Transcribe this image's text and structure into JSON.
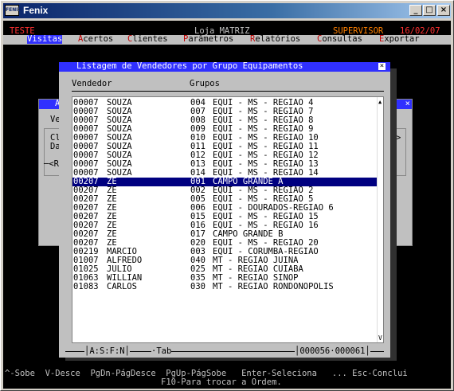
{
  "window": {
    "title": "Fenix",
    "icon_text": "FENIX",
    "minimize": "_",
    "maximize": "□",
    "close": "×"
  },
  "header": {
    "env": "TESTE",
    "store": "Loja MATRIZ",
    "user": "SUPERVISOR",
    "date": "16/02/07"
  },
  "menu": [
    {
      "hot": "V",
      "rest": "isitas",
      "active": true
    },
    {
      "hot": "A",
      "rest": "certos",
      "active": false
    },
    {
      "hot": "C",
      "rest": "lientes",
      "active": false
    },
    {
      "hot": "P",
      "rest": "arâmetros",
      "active": false
    },
    {
      "hot": "R",
      "rest": "elatórios",
      "active": false
    },
    {
      "hot": "C",
      "rest": "onsultas",
      "active": false
    },
    {
      "hot": "E",
      "rest": "xportar",
      "active": false
    }
  ],
  "bg_dialog": {
    "title_fragment": "A",
    "ve": "Ve",
    "cl": "Cl",
    "da": "Da",
    "ret": "─<R",
    "arrow": ">"
  },
  "listing": {
    "title": "Listagem de Vendedores por Grupo Equipamentos",
    "close": "×",
    "col_vendedor": "Vendedor",
    "col_grupos": "Grupos",
    "rows": [
      {
        "cod": "00007",
        "nome": "SOUZA",
        "grp": "004",
        "desc": "EQUI - MS - REGIAO 4",
        "sel": false
      },
      {
        "cod": "00007",
        "nome": "SOUZA",
        "grp": "007",
        "desc": "EQUI - MS - REGIAO 7",
        "sel": false
      },
      {
        "cod": "00007",
        "nome": "SOUZA",
        "grp": "008",
        "desc": "EQUI - MS - REGIAO 8",
        "sel": false
      },
      {
        "cod": "00007",
        "nome": "SOUZA",
        "grp": "009",
        "desc": "EQUI - MS - REGIAO 9",
        "sel": false
      },
      {
        "cod": "00007",
        "nome": "SOUZA",
        "grp": "010",
        "desc": "EQUI - MS - REGIAO 10",
        "sel": false
      },
      {
        "cod": "00007",
        "nome": "SOUZA",
        "grp": "011",
        "desc": "EQUI - MS - REGIAO 11",
        "sel": false
      },
      {
        "cod": "00007",
        "nome": "SOUZA",
        "grp": "012",
        "desc": "EQUI - MS - REGIAO 12",
        "sel": false
      },
      {
        "cod": "00007",
        "nome": "SOUZA",
        "grp": "013",
        "desc": "EQUI - MS - REGIAO 13",
        "sel": false
      },
      {
        "cod": "00007",
        "nome": "SOUZA",
        "grp": "014",
        "desc": "EQUI - MS - REGIAO 14",
        "sel": false
      },
      {
        "cod": "00207",
        "nome": "ZE",
        "grp": "001",
        "desc": "CAMPO GRANDE A",
        "sel": true
      },
      {
        "cod": "00207",
        "nome": "ZE",
        "grp": "002",
        "desc": "EQUI - MS - REGIAO 2",
        "sel": false
      },
      {
        "cod": "00207",
        "nome": "ZE",
        "grp": "005",
        "desc": "EQUI - MS - REGIAO 5",
        "sel": false
      },
      {
        "cod": "00207",
        "nome": "ZE",
        "grp": "006",
        "desc": "EQUI - DOURADOS-REGIAO 6",
        "sel": false
      },
      {
        "cod": "00207",
        "nome": "ZE",
        "grp": "015",
        "desc": "EQUI - MS - REGIAO 15",
        "sel": false
      },
      {
        "cod": "00207",
        "nome": "ZE",
        "grp": "016",
        "desc": "EQUI - MS - REGIAO 16",
        "sel": false
      },
      {
        "cod": "00207",
        "nome": "ZE",
        "grp": "017",
        "desc": "CAMPO GRANDE B",
        "sel": false
      },
      {
        "cod": "00207",
        "nome": "ZE",
        "grp": "020",
        "desc": "EQUI - MS - REGIAO 20",
        "sel": false
      },
      {
        "cod": "00219",
        "nome": "MARCIO",
        "grp": "003",
        "desc": "EQUI - CORUMBA-REGIAO",
        "sel": false
      },
      {
        "cod": "01007",
        "nome": "ALFREDO",
        "grp": "040",
        "desc": "MT - REGIAO JUINA",
        "sel": false
      },
      {
        "cod": "01025",
        "nome": "JULIO",
        "grp": "025",
        "desc": "MT - REGIAO CUIABA",
        "sel": false
      },
      {
        "cod": "01063",
        "nome": "WILLIAN",
        "grp": "035",
        "desc": "MT - REGIAO SINOP",
        "sel": false
      },
      {
        "cod": "01083",
        "nome": "CARLOS",
        "grp": "030",
        "desc": "MT - REGIAO RONDONOPOLIS",
        "sel": false
      }
    ],
    "scroll_up": "▲",
    "scroll_down": "V",
    "status_mode": "A:S:F:N",
    "status_tab": "·Tab",
    "status_count": "000056·000061"
  },
  "hints": {
    "line1": "^-Sobe  V-Desce  PgDn-PágDesce  PgUp-PágSobe   Enter-Seleciona   ... Esc-Conclui",
    "line2": "F10-Para trocar a Ordem."
  },
  "colors": {
    "title_blue": "#3030ff",
    "selection": "#000080",
    "hotkey_red": "#c00000",
    "env_red": "#ff3030",
    "user_orange": "#ff8000"
  }
}
